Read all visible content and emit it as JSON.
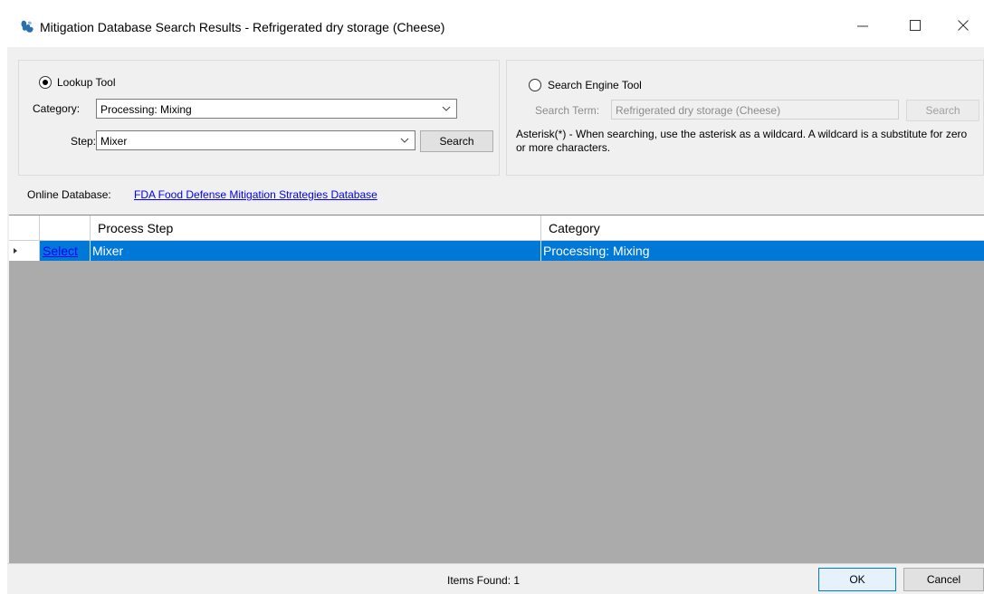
{
  "window": {
    "title": "Mitigation Database Search Results - Refrigerated dry storage (Cheese)",
    "icon": "app-icon",
    "controls": {
      "minimize": "minimize-icon",
      "maximize": "maximize-icon",
      "close": "close-icon"
    }
  },
  "lookup_tool": {
    "label": "Lookup Tool",
    "selected": true,
    "category_label": "Category:",
    "category_value": "Processing: Mixing",
    "step_label": "Step:",
    "step_value": "Mixer",
    "search_button": "Search"
  },
  "search_engine_tool": {
    "label": "Search Engine Tool",
    "selected": false,
    "search_term_label": "Search Term:",
    "search_term_value": "Refrigerated dry storage (Cheese)",
    "search_button": "Search",
    "note": "Asterisk(*) - When searching, use the asterisk as a wildcard.  A wildcard is a substitute for zero or more characters."
  },
  "online_database": {
    "label": "Online Database:",
    "link_text": "FDA Food Defense Mitigation Strategies Database"
  },
  "grid": {
    "columns": [
      "Process Step",
      "Category"
    ],
    "rows": [
      {
        "action": "Select",
        "process_step": "Mixer",
        "category": "Processing: Mixing",
        "selected": true
      }
    ]
  },
  "status": {
    "items_found": "Items Found:  1",
    "ok_button": "OK",
    "cancel_button": "Cancel"
  },
  "colors": {
    "selection": "#0078d7",
    "grid_background": "#ababab",
    "window_background": "#f0f0f0",
    "link": "#0000ee"
  }
}
